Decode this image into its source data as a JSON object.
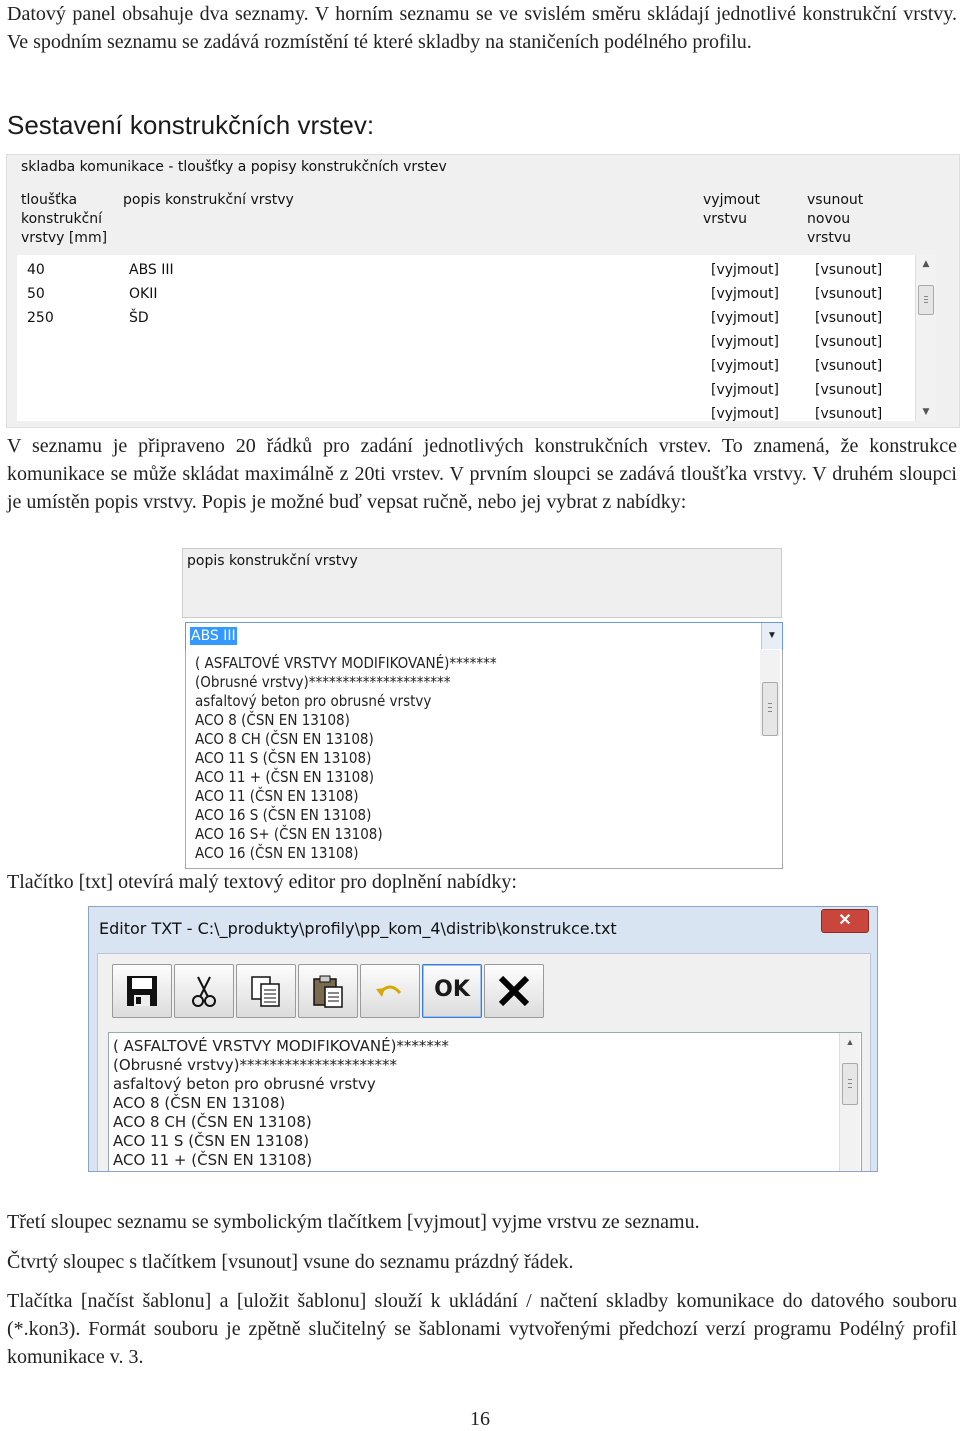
{
  "intro": "Datový panel obsahuje dva seznamy. V horním seznamu se ve svislém směru skládají jednotlivé konstrukční vrstvy. Ve spodním seznamu se zadává rozmístění té které skladby na staničeních podélného profilu.",
  "heading": "Sestavení konstrukčních vrstev:",
  "panel1": {
    "title": "skladba komunikace - tloušťky a popisy konstrukčních vrstev",
    "headers": {
      "thickness": [
        "tloušťka",
        "konstrukční",
        "vrstvy [mm]"
      ],
      "description": "popis konstrukční vrstvy",
      "remove": [
        "vyjmout",
        "vrstvu"
      ],
      "insert": [
        "vsunout",
        "novou",
        "vrstvu"
      ]
    },
    "rows": [
      {
        "thickness": "40",
        "desc": "ABS III",
        "remove": "[vyjmout]",
        "insert": "[vsunout]"
      },
      {
        "thickness": "50",
        "desc": "OKII",
        "remove": "[vyjmout]",
        "insert": "[vsunout]"
      },
      {
        "thickness": "250",
        "desc": "ŠD",
        "remove": "[vyjmout]",
        "insert": "[vsunout]"
      },
      {
        "thickness": "",
        "desc": "",
        "remove": "[vyjmout]",
        "insert": "[vsunout]"
      },
      {
        "thickness": "",
        "desc": "",
        "remove": "[vyjmout]",
        "insert": "[vsunout]"
      },
      {
        "thickness": "",
        "desc": "",
        "remove": "[vyjmout]",
        "insert": "[vsunout]"
      },
      {
        "thickness": "",
        "desc": "",
        "remove": "[vyjmout]",
        "insert": "[vsunout]"
      }
    ]
  },
  "para2": "V seznamu je připraveno 20 řádků pro zadání jednotlivých konstrukčních vrstev. To znamená, že konstrukce komunikace se může skládat maximálně z 20ti vrstev. V prvním sloupci se zadává tloušťka vrstvy. V druhém sloupci je umístěn popis vrstvy. Popis je možné buď vepsat ručně, nebo jej vybrat z nabídky:",
  "panel2": {
    "title": "popis konstrukční vrstvy",
    "combo_value": "ABS III",
    "options": [
      "( ASFALTOVÉ VRSTVY MODIFIKOVANÉ)*******",
      "(Obrusné vrstvy)*********************",
      "asfaltový beton pro obrusné vrstvy",
      "ACO 8  (ČSN EN 13108)",
      "ACO 8 CH  (ČSN EN 13108)",
      "ACO 11 S (ČSN EN 13108)",
      "ACO 11 +  (ČSN EN 13108)",
      "ACO 11 (ČSN EN 13108)",
      "ACO 16 S (ČSN EN 13108)",
      "ACO 16 S+ (ČSN EN 13108)",
      "ACO 16 (ČSN EN 13108)"
    ]
  },
  "para3": "Tlačítko [txt] otevírá malý textový editor pro doplnění nabídky:",
  "editor": {
    "title": "Editor TXT - C:\\_produkty\\profily\\pp_kom_4\\distrib\\konstrukce.txt",
    "close": "✕",
    "ok_label": "OK",
    "lines": [
      "( ASFALTOVÉ VRSTVY MODIFIKOVANÉ)*******",
      "(Obrusné vrstvy)*********************",
      "asfaltový beton pro obrusné vrstvy",
      "ACO 8  (ČSN EN 13108)",
      "ACO 8 CH  (ČSN EN 13108)",
      "ACO 11 S (ČSN EN 13108)",
      "ACO 11 +  (ČSN EN 13108)"
    ]
  },
  "para4": "Třetí sloupec seznamu se symbolickým tlačítkem [vyjmout] vyjme vrstvu ze seznamu.",
  "para5": "Čtvrtý sloupec s tlačítkem [vsunout] vsune do seznamu prázdný řádek.",
  "para6": "Tlačítka [načíst šablonu] a [uložit šablonu] slouží k ukládání / načtení skladby komunikace do datového souboru (*.kon3). Formát souboru je zpětně slučitelný se šablonami vytvořenými předchozí verzí programu Podélný profil komunikace v. 3.",
  "page_number": "16"
}
